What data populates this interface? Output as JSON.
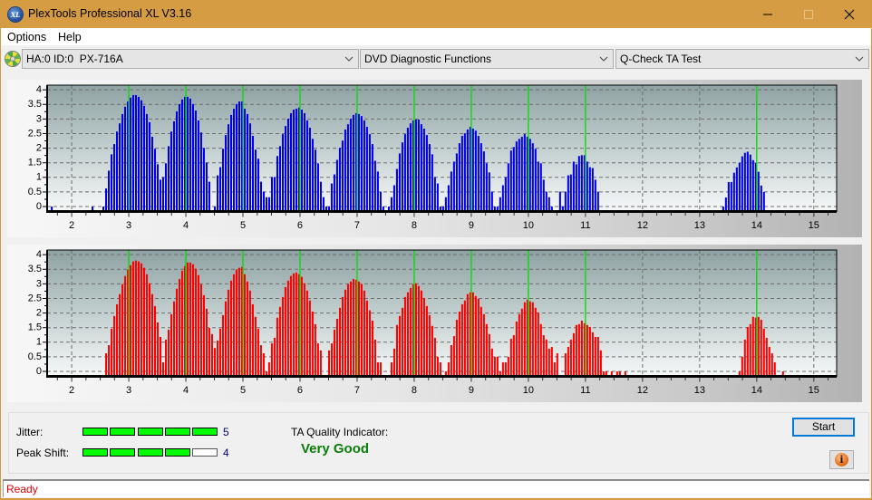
{
  "window": {
    "title": "PlexTools Professional XL V3.16",
    "icon_label": "XL",
    "controls": [
      "minimize",
      "maximize",
      "close"
    ]
  },
  "menu": {
    "items": [
      "Options",
      "Help"
    ]
  },
  "toolbar": {
    "drive_select": "HA:0 ID:0  PX-716A",
    "function_select": "DVD Diagnostic Functions",
    "test_select": "Q-Check TA Test"
  },
  "results": {
    "jitter": {
      "label": "Jitter:",
      "value": 5,
      "max": 5
    },
    "peak_shift": {
      "label": "Peak Shift:",
      "value": 4,
      "max": 5
    },
    "ta_quality": {
      "label": "TA Quality Indicator:",
      "value": "Very Good"
    }
  },
  "buttons": {
    "start": "Start",
    "info_icon": "i"
  },
  "status": {
    "text": "Ready"
  },
  "colors": {
    "title_bar": "#d69c43",
    "top_series": "#0000ee",
    "bottom_series": "#ff0000",
    "reference_line": "#00dd00",
    "meter_on": "#00ff00",
    "quality_text": "#0a7d0a",
    "status_text": "#e00000"
  },
  "chart_data": [
    {
      "type": "bar",
      "title": "",
      "xlabel": "",
      "ylabel": "",
      "xlim": [
        1.57,
        15.4
      ],
      "ylim": [
        -0.17,
        4.16
      ],
      "xticks": [
        2,
        3,
        4,
        5,
        6,
        7,
        8,
        9,
        10,
        11,
        12,
        13,
        14,
        15
      ],
      "yticks": [
        0,
        0.5,
        1,
        1.5,
        2,
        2.5,
        3,
        3.5,
        4
      ],
      "grid": true,
      "bin_width": 0.0476,
      "reference_lines": {
        "x": [
          3,
          4,
          5,
          6,
          7,
          8,
          9,
          10,
          11,
          14
        ],
        "color": "#00dd00"
      },
      "series": [
        {
          "color": "#0000ee",
          "segments": [
            {
              "x_start": 1.651,
              "values": [
                0
              ]
            },
            {
              "x_start": 2.365,
              "values": [
                0
              ]
            },
            {
              "x_start": 2.555,
              "values": [
                0,
                0.62,
                1.23,
                1.79,
                2.14,
                2.57,
                2.85,
                3.17,
                3.42,
                3.6,
                3.73,
                3.82,
                3.82,
                3.76,
                3.64,
                3.45,
                3.17,
                2.89,
                2.39,
                1.98,
                1.45,
                0.92,
                1.01,
                1.48,
                2.07,
                2.57,
                2.92,
                3.26,
                3.51,
                3.67,
                3.76,
                3.76,
                3.7,
                3.51,
                3.29,
                2.95,
                2.54,
                2.01,
                1.51,
                0.85
              ]
            },
            {
              "x_start": 4.508,
              "values": [
                0,
                1.07,
                1.35,
                1.98,
                2.45,
                2.82,
                3.14,
                3.35,
                3.51,
                3.6,
                3.6,
                3.35,
                3.17,
                2.85,
                2.42,
                1.95,
                1.64,
                0.85,
                0.51,
                0.32,
                0.32,
                1.01,
                1.01,
                1.73,
                2.07,
                2.48,
                2.76,
                3.01,
                3.2,
                3.32,
                3.35,
                3.39,
                3.32,
                3.2,
                2.95,
                2.7,
                2.32,
                1.95,
                1.48,
                0.85,
                0.32,
                0,
                0,
                0.79,
                1.1,
                1.6,
                2.01,
                2.26,
                2.64,
                2.82,
                3.01,
                3.14,
                3.2,
                3.17,
                3.1,
                2.95,
                2.73,
                2.48,
                2.14,
                1.57,
                1.2,
                0.51,
                0
              ]
            },
            {
              "x_start": 7.555,
              "values": [
                0,
                0.32,
                0.73,
                1.29,
                1.82,
                2.2,
                2.48,
                2.7,
                2.85,
                2.95,
                2.98,
                2.98,
                2.82,
                2.67,
                2.45,
                2.14,
                1.79,
                1.01,
                0.79,
                0,
                0,
                0.32,
                0.73,
                1.2,
                1.54,
                1.82,
                2.17,
                2.42,
                2.51,
                2.64,
                2.73,
                2.67,
                2.6,
                2.42,
                2.17,
                1.89,
                1.48,
                1.17,
                0.51,
                0,
                0,
                0.32,
                0.73,
                1.01,
                1.48,
                1.92,
                2.04,
                2.23,
                2.32,
                2.39,
                2.48,
                2.39,
                2.32,
                2.17,
                1.98,
                1.54,
                1.48,
                0.92,
                0.51,
                0.32,
                0
              ]
            },
            {
              "x_start": 10.555,
              "values": [
                0.51,
                0,
                0.51,
                1.07,
                1.1,
                1.54,
                1.45,
                1.73,
                1.76,
                1.76,
                1.54,
                1.35,
                1.32,
                0.92,
                0.51
              ]
            },
            {
              "x_start": 13.413,
              "values": [
                0,
                0.31,
                0.84,
                0.84,
                1.16,
                1.34,
                1.5,
                1.72,
                1.84,
                1.88,
                1.78,
                1.59,
                1.5,
                1.19,
                0.72,
                0.5
              ]
            }
          ]
        }
      ]
    },
    {
      "type": "bar",
      "title": "",
      "xlabel": "",
      "ylabel": "",
      "xlim": [
        1.57,
        15.4
      ],
      "ylim": [
        -0.17,
        4.16
      ],
      "xticks": [
        2,
        3,
        4,
        5,
        6,
        7,
        8,
        9,
        10,
        11,
        12,
        13,
        14,
        15
      ],
      "yticks": [
        0,
        0.5,
        1,
        1.5,
        2,
        2.5,
        3,
        3.5,
        4
      ],
      "grid": true,
      "bin_width": 0.0476,
      "reference_lines": {
        "x": [
          3,
          4,
          5,
          6,
          7,
          8,
          9,
          10,
          11,
          14
        ],
        "color": "#00dd00"
      },
      "series": [
        {
          "color": "#ff0000",
          "segments": [
            {
              "x_start": 2.603,
              "values": [
                0.62,
                0.9,
                1.46,
                1.9,
                2.3,
                2.65,
                2.99,
                3.27,
                3.49,
                3.64,
                3.77,
                3.8,
                3.77,
                3.7,
                3.55,
                3.33,
                3.02,
                2.65,
                2.24,
                1.68,
                1.18,
                0.31,
                1.09,
                1.43,
                1.96,
                2.4,
                2.83,
                3.17,
                3.45,
                3.61,
                3.73,
                3.73,
                3.67,
                3.52,
                3.3,
                2.99,
                2.61,
                2.15,
                1.49,
                1.28,
                0.8,
                1.06,
                1.46,
                1.93,
                2.4,
                2.8,
                3.11,
                3.33,
                3.49,
                3.55,
                3.58,
                3.33,
                3.08,
                2.77,
                2.3,
                1.87,
                1.46,
                0.9,
                0.62,
                0,
                0.31,
                0.96,
                1.15,
                1.84,
                2.21,
                2.55,
                2.89,
                3.11,
                3.27,
                3.36,
                3.39,
                3.33,
                3.24,
                3.02,
                2.77,
                2.43,
                2.05,
                1.62,
                0.96,
                0.72
              ]
            },
            {
              "x_start": 6.508,
              "values": [
                0.72,
                0.96,
                1.43,
                1.8,
                2.18,
                2.55,
                2.8,
                2.99,
                3.08,
                3.17,
                3.14,
                3.08,
                2.99,
                2.77,
                2.43,
                2.09,
                1.74,
                1.09,
                0.31,
                0.31
              ]
            },
            {
              "x_start": 7.603,
              "values": [
                0.31,
                0.78,
                1.59,
                1.9,
                2.18,
                2.55,
                2.71,
                2.86,
                2.99,
                3.02,
                2.93,
                2.77,
                2.52,
                2.24,
                1.93,
                1.56,
                1.15,
                0.5,
                0.31
              ]
            },
            {
              "x_start": 8.555,
              "values": [
                0,
                0.31,
                0.9,
                1.21,
                1.77,
                2.05,
                2.3,
                2.43,
                2.65,
                2.71,
                2.71,
                2.58,
                2.49,
                2.21,
                1.96,
                1.62,
                1.28,
                0.78,
                0.5,
                0.5,
                0,
                0.31,
                0.31,
                0.5,
                1.12,
                1.24,
                1.71,
                1.96,
                2.15,
                2.37,
                2.46,
                2.4,
                2.37,
                2.18,
                2.02,
                1.62,
                1.24,
                1.09,
                0.78,
                0.84,
                0.31,
                0.62
              ]
            },
            {
              "x_start": 10.651,
              "values": [
                0.62,
                0.84,
                1.09,
                1.31,
                1.59,
                1.62,
                1.74,
                1.65,
                1.59,
                1.52,
                1.34,
                1.18,
                1.18,
                0.72,
                0,
                0
              ]
            },
            {
              "x_start": 11.46,
              "values": [
                0
              ]
            },
            {
              "x_start": 11.555,
              "values": [
                0,
                0
              ]
            },
            {
              "x_start": 11.698,
              "values": [
                0
              ]
            },
            {
              "x_start": 13.698,
              "values": [
                0,
                0.5,
                1.09,
                1.52,
                1.62,
                1.87,
                1.84,
                1.87,
                1.77,
                1.46,
                1.15,
                0.84,
                0.62,
                0.31
              ]
            },
            {
              "x_start": 14.46,
              "values": [
                0
              ]
            }
          ]
        }
      ]
    }
  ]
}
